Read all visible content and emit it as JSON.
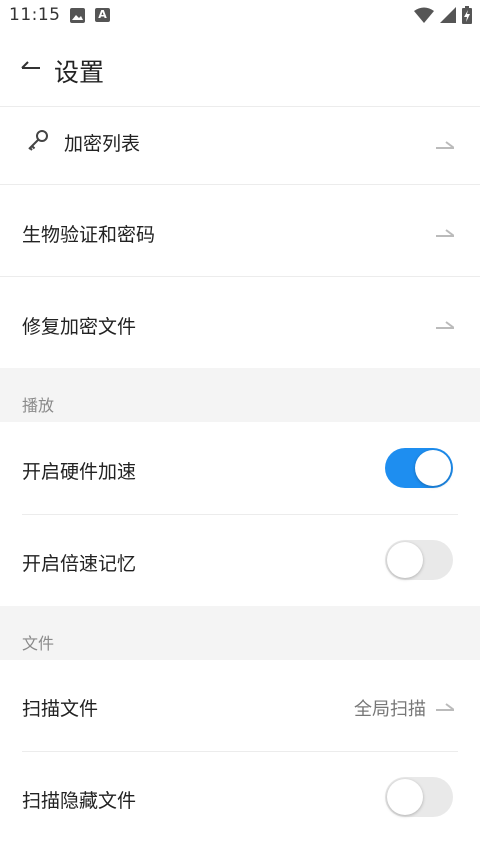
{
  "status": {
    "time": "11:15"
  },
  "header": {
    "title": "设置"
  },
  "rows": {
    "encrypt_list": "加密列表",
    "biometric": "生物验证和密码",
    "repair": "修复加密文件"
  },
  "sections": {
    "playback": {
      "title": "播放",
      "hw_accel": {
        "label": "开启硬件加速",
        "enabled": true
      },
      "speed_memory": {
        "label": "开启倍速记忆",
        "enabled": false
      }
    },
    "file": {
      "title": "文件",
      "scan_files": {
        "label": "扫描文件",
        "value": "全局扫描"
      },
      "scan_hidden": {
        "label": "扫描隐藏文件",
        "enabled": false
      }
    }
  },
  "colors": {
    "accent": "#1e8ef0",
    "section_bg": "#f4f4f4"
  },
  "icons": [
    "image-icon",
    "text-a-icon",
    "wifi-icon",
    "signal-icon",
    "battery-charging-icon",
    "back-arrow-icon",
    "key-icon",
    "chevron-right-icon"
  ]
}
